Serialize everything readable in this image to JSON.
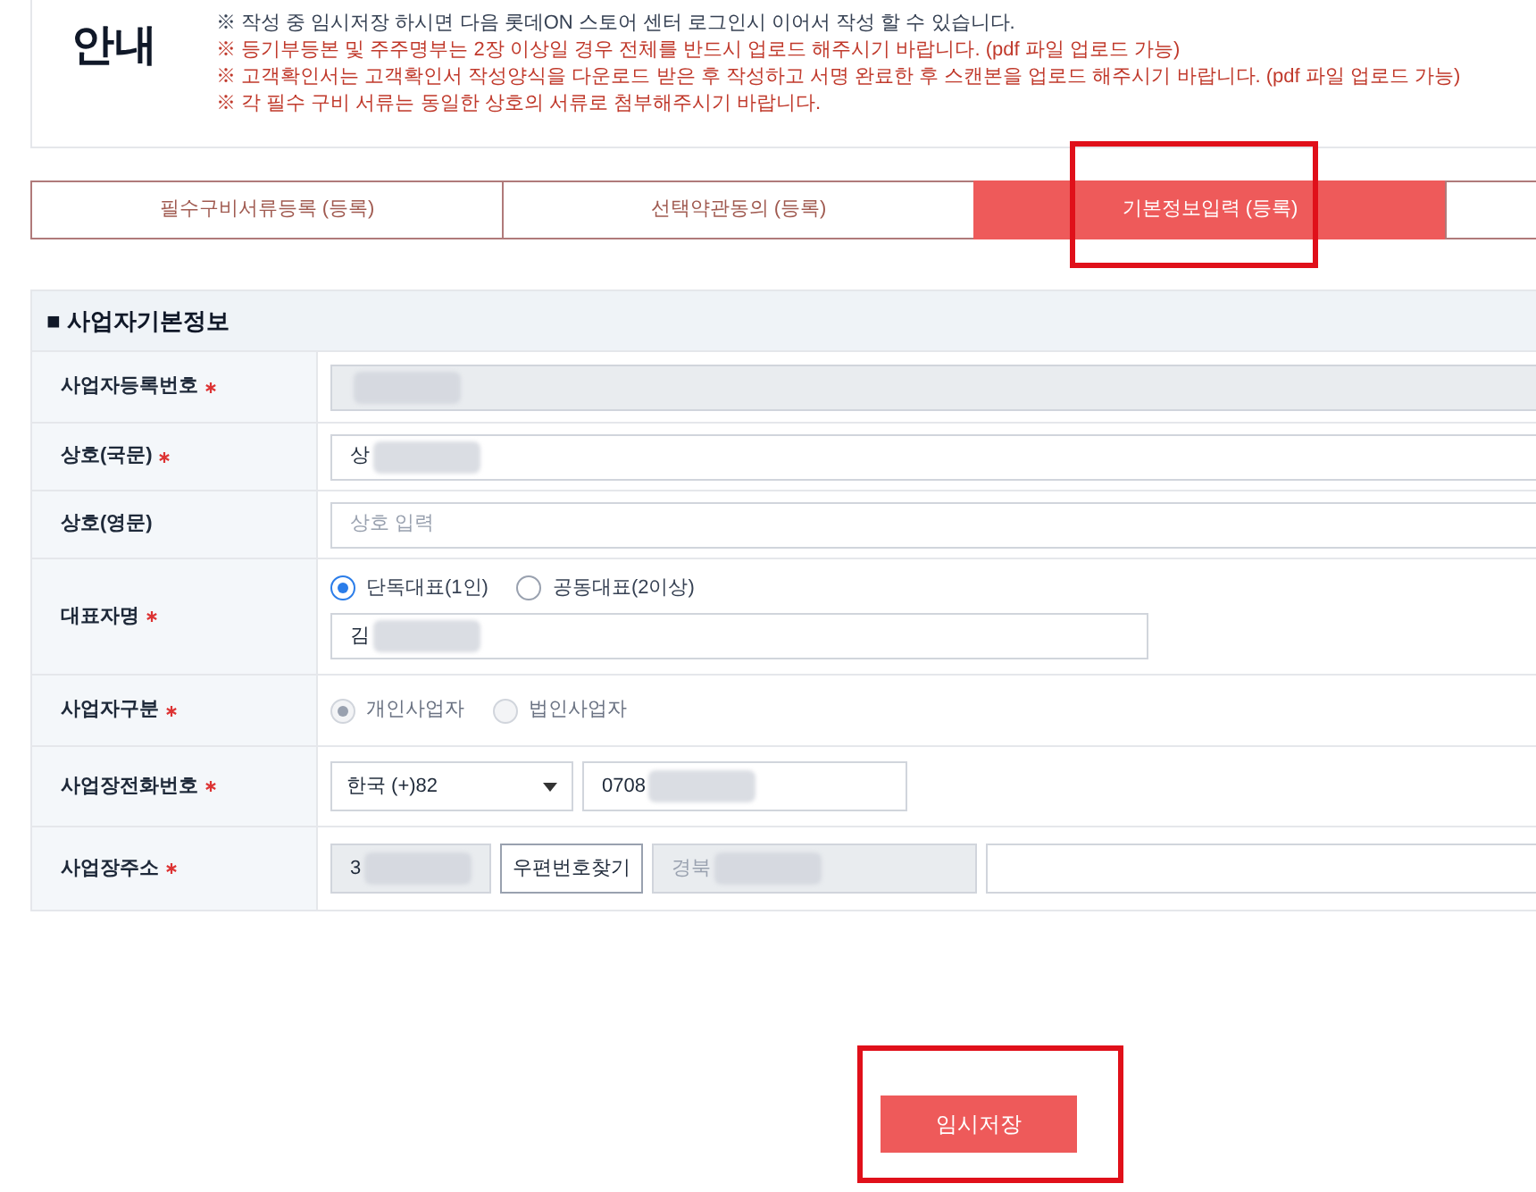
{
  "notice": {
    "title": "안내",
    "lines": [
      {
        "text": "※ 작성 중 임시저장 하시면 다음 롯데ON 스토어 센터 로그인시 이어서 작성 할 수 있습니다.",
        "emphasis": false
      },
      {
        "text": "※ 등기부등본 및 주주명부는 2장 이상일 경우 전체를 반드시 업로드 해주시기 바랍니다. (pdf 파일 업로드 가능)",
        "emphasis": true
      },
      {
        "text": "※ 고객확인서는 고객확인서 작성양식을 다운로드 받은 후 작성하고 서명 완료한 후 스캔본을 업로드 해주시기 바랍니다. (pdf 파일 업로드 가능)",
        "emphasis": true
      },
      {
        "text": "※ 각 필수 구비 서류는 동일한 상호의 서류로 첨부해주시기 바랍니다.",
        "emphasis": true
      }
    ]
  },
  "steps": [
    {
      "label": "필수구비서류등록 (등록)",
      "selected": false
    },
    {
      "label": "선택약관동의 (등록)",
      "selected": false
    },
    {
      "label": "기본정보입력 (등록)",
      "selected": true,
      "highlighted": true
    },
    {
      "selected": false
    }
  ],
  "section": {
    "title": "■ 사업자기본정보"
  },
  "rows": [
    {
      "label": "사업자등록번호",
      "required": true,
      "kind": "readonly",
      "redacted": true
    },
    {
      "label": "상호(국문)",
      "required": true,
      "kind": "text",
      "value": "상",
      "redacted": true
    },
    {
      "label": "상호(영문)",
      "kind": "text",
      "placeholder": "상호 입력"
    },
    {
      "label": "대표자명",
      "required": true,
      "kind": "radio_text",
      "options": [
        {
          "label": "단독대표(1인)",
          "selected": true,
          "disabled": false
        },
        {
          "label": "공동대표(2이상)",
          "selected": false,
          "disabled": false
        }
      ],
      "value": "김",
      "redacted": true
    },
    {
      "label": "사업자구분",
      "required": true,
      "kind": "radio",
      "options": [
        {
          "label": "개인사업자",
          "selected": true,
          "disabled": true
        },
        {
          "label": "법인사업자",
          "selected": false,
          "disabled": true
        }
      ]
    },
    {
      "label": "사업장전화번호",
      "required": true,
      "kind": "phone",
      "country": "한국 (+)82",
      "value": "0708",
      "redacted": true
    },
    {
      "label": "사업장주소",
      "required": true,
      "kind": "address",
      "zip": "3",
      "button": "우편번호찾기",
      "address": "경북",
      "redacted": true
    }
  ],
  "save_button": {
    "label": "임시저장",
    "highlighted": true
  }
}
